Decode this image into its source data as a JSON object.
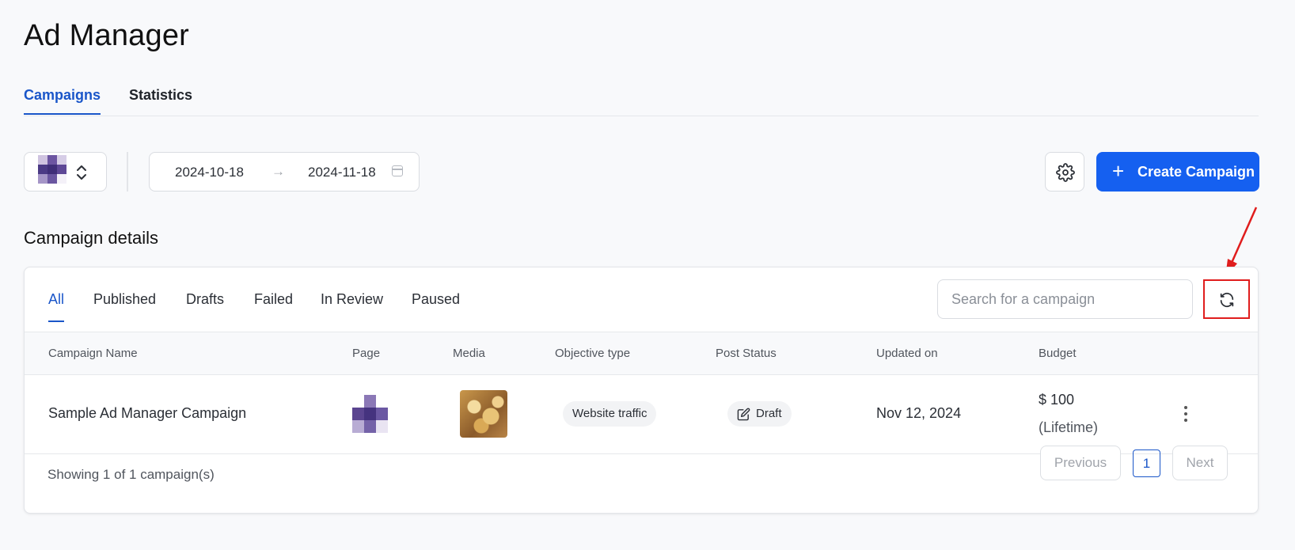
{
  "header": {
    "title": "Ad Manager"
  },
  "main_tabs": [
    {
      "label": "Campaigns",
      "active": true
    },
    {
      "label": "Statistics",
      "active": false
    }
  ],
  "toolbar": {
    "date_start": "2024-10-18",
    "date_end": "2024-11-18",
    "arrow_glyph": "→",
    "create_label": "Create Campaign",
    "create_plus": "+"
  },
  "section": {
    "title": "Campaign details"
  },
  "filter_tabs": [
    {
      "label": "All",
      "active": true
    },
    {
      "label": "Published"
    },
    {
      "label": "Drafts"
    },
    {
      "label": "Failed"
    },
    {
      "label": "In Review"
    },
    {
      "label": "Paused"
    }
  ],
  "search": {
    "placeholder": "Search for a campaign"
  },
  "table": {
    "headers": [
      "Campaign Name",
      "Page",
      "Media",
      "Objective type",
      "Post Status",
      "Updated on",
      "Budget"
    ],
    "rows": [
      {
        "name": "Sample Ad Manager Campaign",
        "objective": "Website traffic",
        "status": "Draft",
        "updated": "Nov 12, 2024",
        "budget": "$ 100",
        "budget_period": "(Lifetime)"
      }
    ]
  },
  "footer": {
    "showing": "Showing 1 of 1 campaign(s)",
    "previous": "Previous",
    "page": "1",
    "next": "Next"
  },
  "colors": {
    "accent": "#1a56c9",
    "primary_button": "#1560f0",
    "highlight": "#e01d1d",
    "avatar_purple": "#5b4590"
  },
  "icons": {
    "page_select": "chevron-up-down-icon",
    "date": "calendar-icon",
    "settings": "gear-icon",
    "refresh": "refresh-icon",
    "status": "edit-icon",
    "row_menu": "kebab-icon"
  }
}
